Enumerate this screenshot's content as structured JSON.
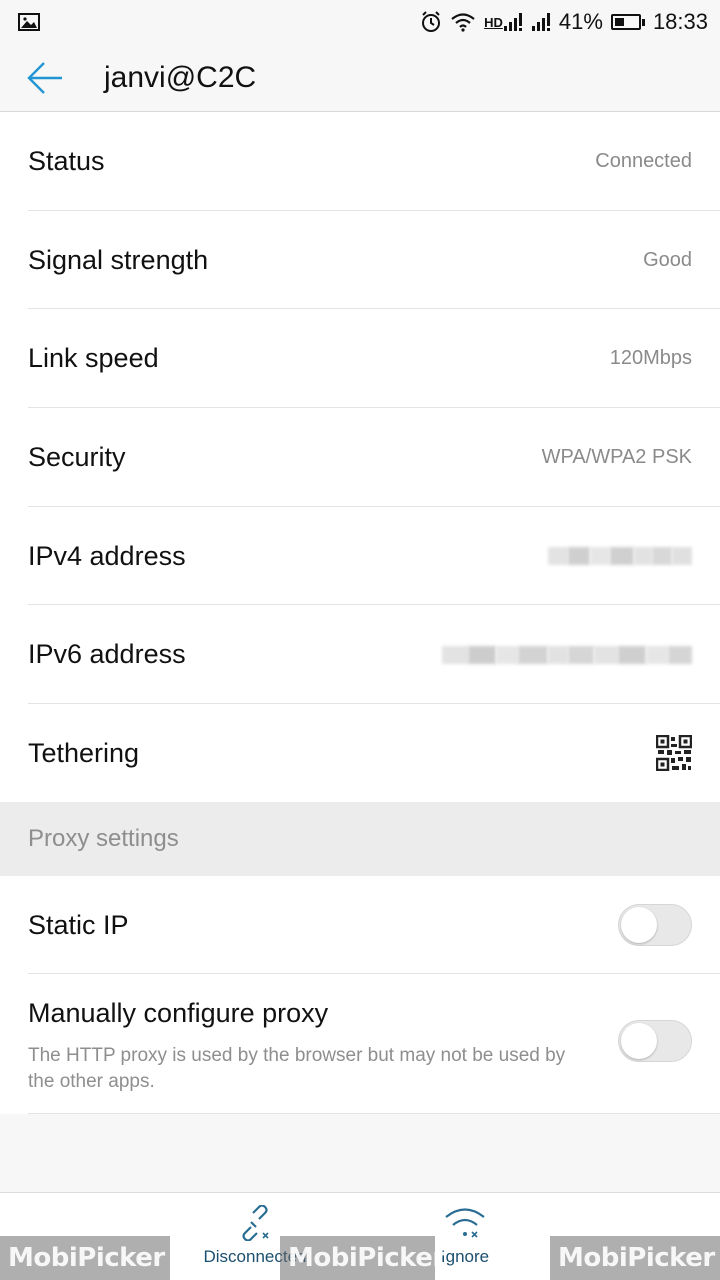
{
  "status_bar": {
    "battery_percent": "41%",
    "battery_level": 0.41,
    "time": "18:33",
    "network_label": "HD"
  },
  "app_bar": {
    "title": "janvi@C2C",
    "accent_color": "#2196d3"
  },
  "details": {
    "status": {
      "label": "Status",
      "value": "Connected"
    },
    "signal": {
      "label": "Signal strength",
      "value": "Good"
    },
    "link_speed": {
      "label": "Link speed",
      "value": "120Mbps"
    },
    "security": {
      "label": "Security",
      "value": "WPA/WPA2 PSK"
    },
    "ipv4": {
      "label": "IPv4 address"
    },
    "ipv6": {
      "label": "IPv6 address"
    },
    "tethering": {
      "label": "Tethering",
      "icon": "qr-code-icon"
    }
  },
  "proxy": {
    "section_title": "Proxy settings",
    "static_ip": {
      "label": "Static IP",
      "enabled": false
    },
    "manual_proxy": {
      "label": "Manually configure proxy",
      "description": "The HTTP proxy is used by the browser but may not be used by the other apps.",
      "enabled": false
    }
  },
  "bottom_bar": {
    "disconnect_label": "Disconnected",
    "ignore_label": "Ignore"
  },
  "watermark": {
    "text": "MobiPicker"
  }
}
